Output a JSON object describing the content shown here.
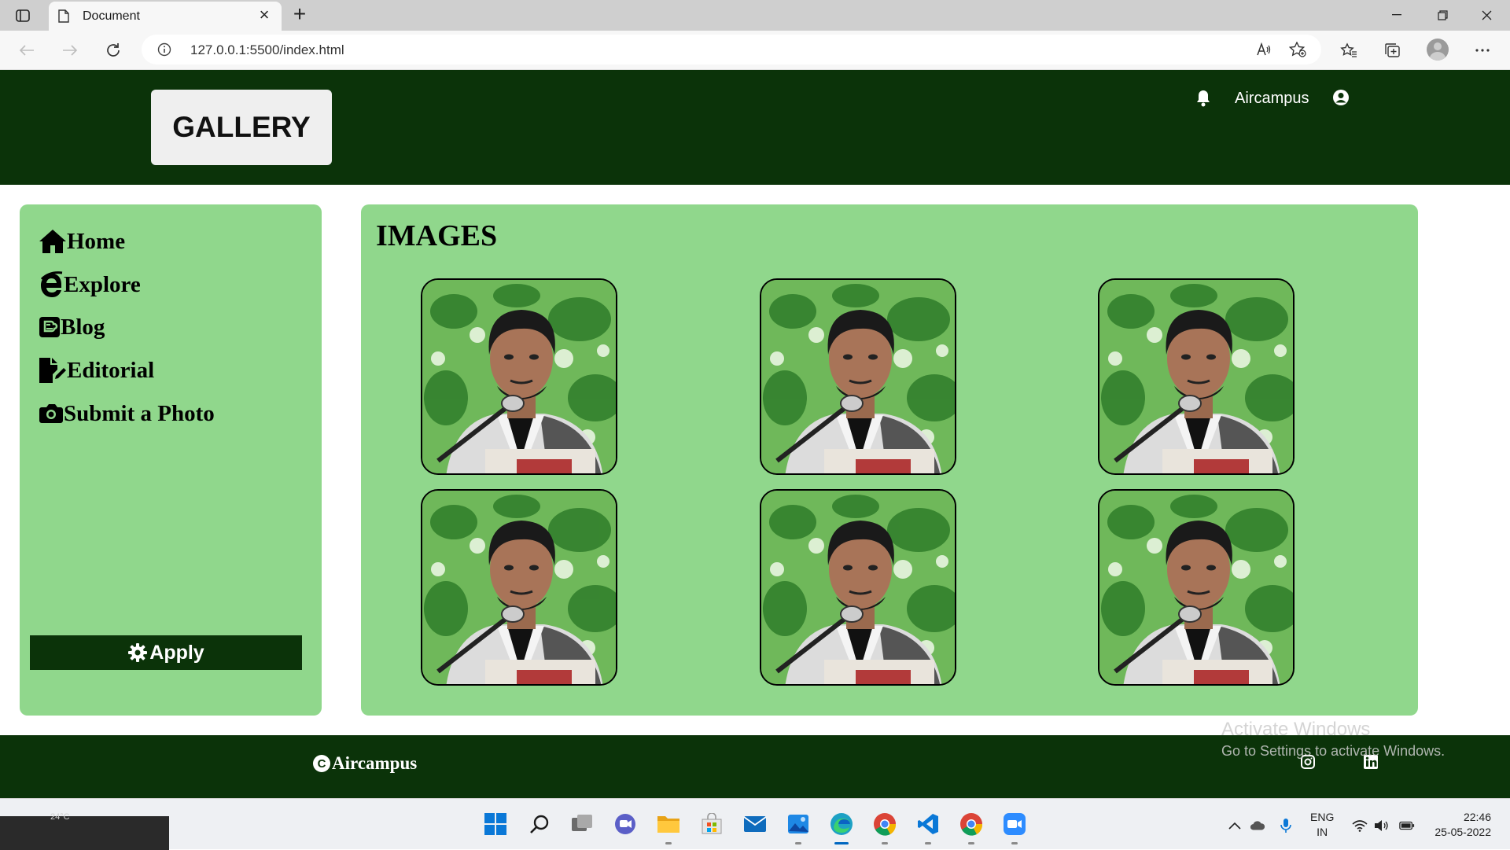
{
  "browser": {
    "tab_title": "Document",
    "url": "127.0.0.1:5500/index.html"
  },
  "header": {
    "logo": "GALLERY",
    "username": "Aircampus"
  },
  "sidebar": {
    "items": [
      {
        "label": "Home",
        "icon": "home-icon"
      },
      {
        "label": "Explore",
        "icon": "internet-explorer-icon"
      },
      {
        "label": "Blog",
        "icon": "blogger-icon"
      },
      {
        "label": "Editorial",
        "icon": "file-signature-icon"
      },
      {
        "label": "Submit a Photo",
        "icon": "camera-icon"
      }
    ],
    "apply_label": "Apply"
  },
  "main": {
    "title": "IMAGES",
    "photo_count": 6
  },
  "footer": {
    "copyright": "Aircampus",
    "activate_title": "Activate Windows",
    "activate_subtitle": "Go to Settings to activate Windows."
  },
  "taskbar": {
    "weather": "24°C",
    "lang_line1": "ENG",
    "lang_line2": "IN",
    "time": "22:46",
    "date": "25-05-2022"
  },
  "colors": {
    "header_bg": "#0b3309",
    "panel_bg": "#90d78c",
    "logo_bg": "#efefef"
  }
}
